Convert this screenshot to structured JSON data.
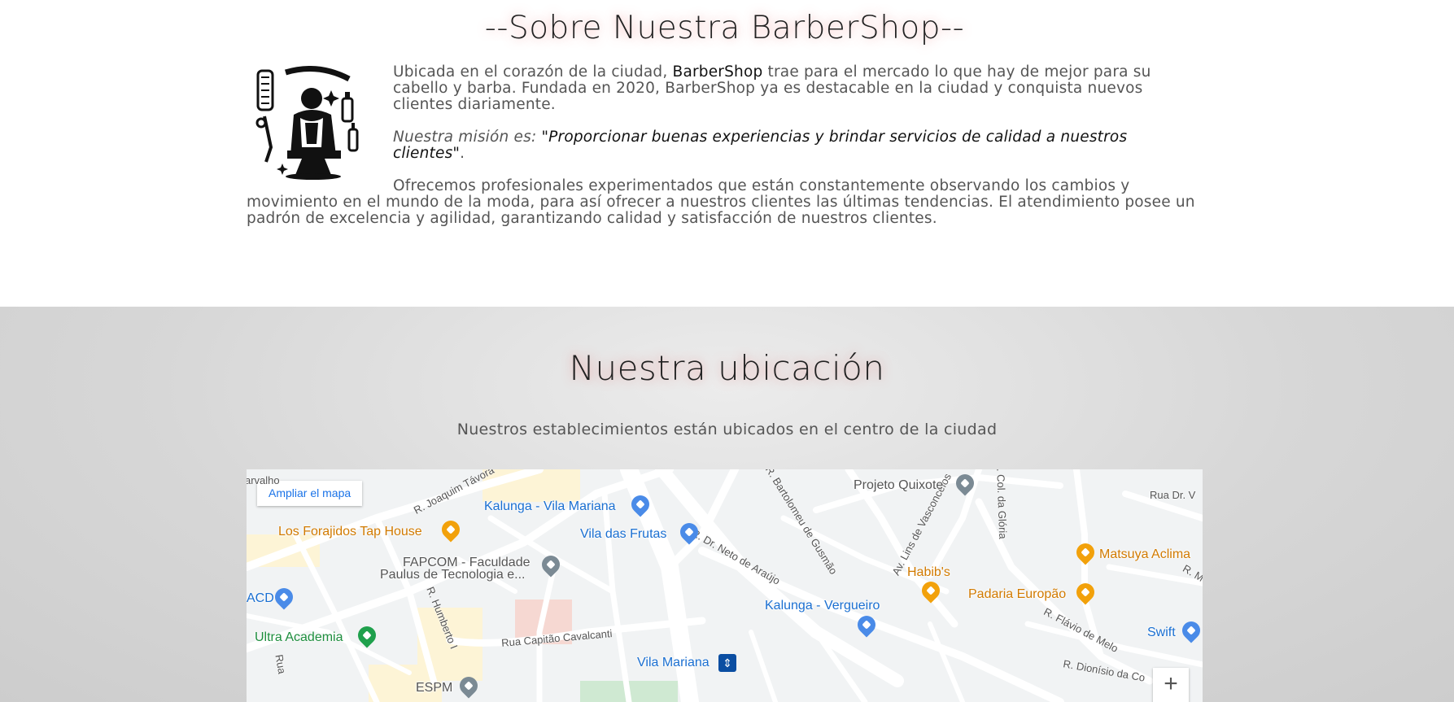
{
  "about": {
    "title": "--Sobre Nuestra BarberShop--",
    "image_icon": "barber-illustration",
    "p1_a": "Ubicada en el corazón de la ciudad, ",
    "p1_brand": "BarberShop",
    "p1_b": " trae para el mercado lo que hay de mejor para su cabello y barba. Fundada en 2020, BarberShop ya es destacable en la ciudad y conquista nuevos clientes diariamente.",
    "mission_label": "Nuestra misión es: ",
    "mission_quote": "\"Proporcionar buenas experiencias y brindar servicios de calidad a nuestros clientes\"",
    "mission_end": ".",
    "p3": "Ofrecemos profesionales experimentados que están constantemente observando los cambios y movimiento en el mundo de la moda, para así ofrecer a nuestros clientes las últimas tendencias. El atendimiento posee un padrón de excelencia y agilidad, garantizando calidad y satisfacción de nuestros clientes."
  },
  "location": {
    "title": "Nuestra ubicación",
    "subtitle": "Nuestros establecimientos están ubicados en el centro de la ciudad",
    "map": {
      "enlarge_button": "Ampliar el mapa",
      "zoom_in": "+",
      "pois": {
        "kalunga_vm": "Kalunga - Vila Mariana",
        "forajidos": "Los Forajidos Tap House",
        "vila_frutas": "Vila das Frutas",
        "fapcom_1": "FAPCOM - Faculdade",
        "fapcom_2": "Paulus de Tecnologia e...",
        "projeto_quixote": "Projeto Quixote",
        "habibs": "Habib's",
        "matsuya": "Matsuya Aclima",
        "padaria": "Padaria Europão",
        "kalunga_verg": "Kalunga - Vergueiro",
        "acd": "ACD",
        "ultra": "Ultra Academia",
        "swift": "Swift",
        "espm": "ESPM",
        "vila_mariana": "Vila Mariana"
      },
      "streets": {
        "joaquim": "R. Joaquim Távora",
        "bartolomeu": "R. Bartolomeu de Gusmão",
        "neto": "R. Dr. Neto de Araújo",
        "lins": "Av. Lins de Vasconcelos",
        "gloria": "R. Col. da Glória",
        "humberto": "R. Humberto I",
        "capitao": "Rua Capitão Cavalcanti",
        "flavio": "R. Flávio de Melo",
        "dionisio": "R. Dionísio da Co",
        "dr_v": "Rua Dr. V",
        "rua": "Rua",
        "carvalho": "arvalho",
        "r_m": "R. M"
      }
    }
  }
}
